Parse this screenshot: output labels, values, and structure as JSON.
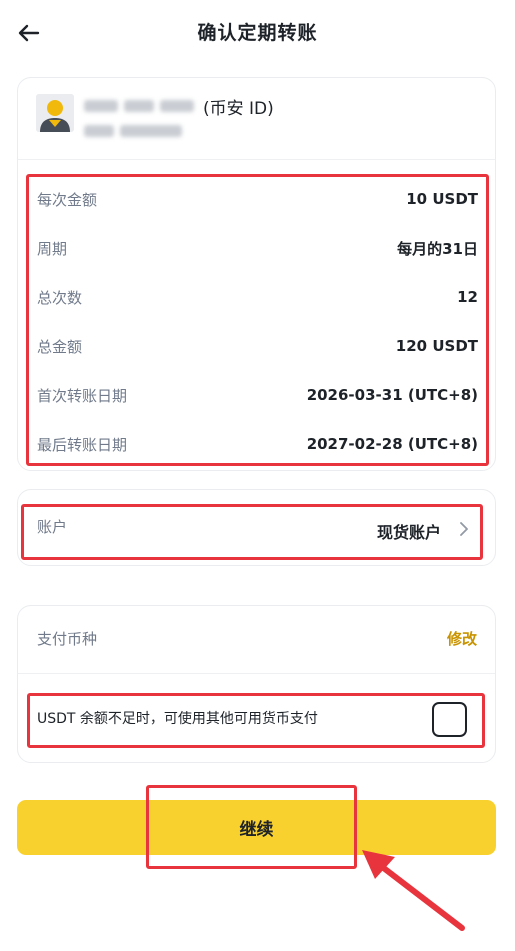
{
  "header": {
    "title": "确认定期转账",
    "back_icon": "arrow-left-icon"
  },
  "recipient": {
    "id_type": "(币安 ID)",
    "avatar_icon": "user-avatar-icon"
  },
  "details": [
    {
      "label": "每次金额",
      "value": "10 USDT"
    },
    {
      "label": "周期",
      "value": "每月的31日"
    },
    {
      "label": "总次数",
      "value": "12"
    },
    {
      "label": "总金额",
      "value": "120 USDT"
    },
    {
      "label": "首次转账日期",
      "value": "2026-03-31 (UTC+8)"
    },
    {
      "label": "最后转账日期",
      "value": "2027-02-28 (UTC+8)"
    }
  ],
  "account": {
    "label": "账户",
    "value": "现货账户",
    "chevron_icon": "chevron-right-icon"
  },
  "payment": {
    "label": "支付币种",
    "edit_label": "修改",
    "fallback_text": "USDT 余额不足时，可使用其他可用货币支付",
    "fallback_checked": false
  },
  "continue_label": "继续",
  "colors": {
    "accent": "#F8D12F",
    "link": "#C99400",
    "highlight": "#E8353D"
  }
}
